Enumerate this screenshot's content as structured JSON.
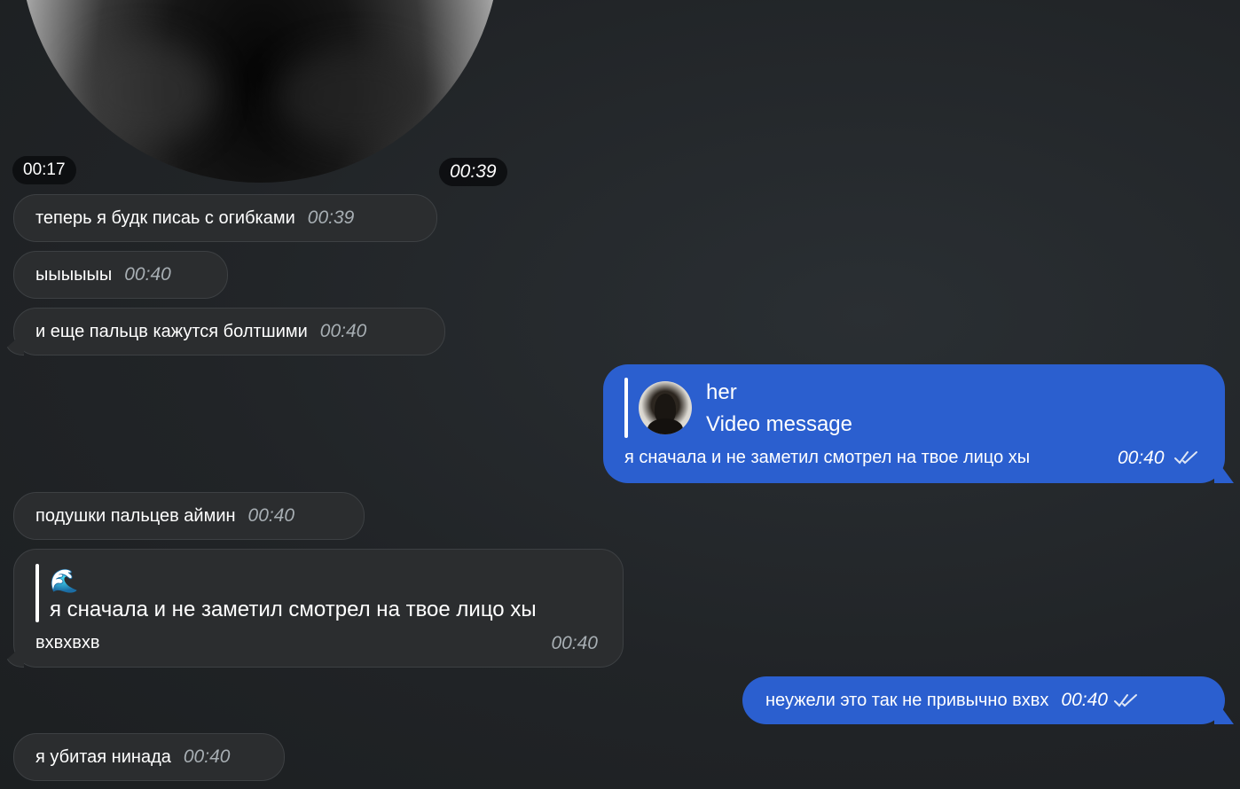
{
  "video": {
    "duration": "00:17",
    "time": "00:39"
  },
  "messages": {
    "m1": {
      "text": "теперь я будк писаь с огибками",
      "time": "00:39"
    },
    "m2": {
      "text": "ыыыыыы",
      "time": "00:40"
    },
    "m3": {
      "text": "и еще пальцв кажутся болтшими",
      "time": "00:40"
    },
    "out1": {
      "reply_name": "her",
      "reply_text": "Video message",
      "text": "я сначала и не заметил смотрел на твое лицо хы",
      "time": "00:40",
      "status_icon": "double-check-icon"
    },
    "m4": {
      "text": "подушки пальцев аймин",
      "time": "00:40"
    },
    "m5": {
      "reply_emoji": "🌊",
      "reply_text": "я сначала и не заметил смотрел на твое лицо хы",
      "text": "вхвхвхв",
      "time": "00:40"
    },
    "out2": {
      "text": "неужели это так не привычно вхвх",
      "time": "00:40",
      "status_icon": "double-check-icon"
    },
    "m6": {
      "text": "я убитая нинада",
      "time": "00:40"
    }
  },
  "colors": {
    "background": "#212427",
    "incoming_bubble": "#2b2d2f",
    "outgoing_bubble": "#2b5fcf",
    "incoming_time": "#a7aeb3"
  }
}
